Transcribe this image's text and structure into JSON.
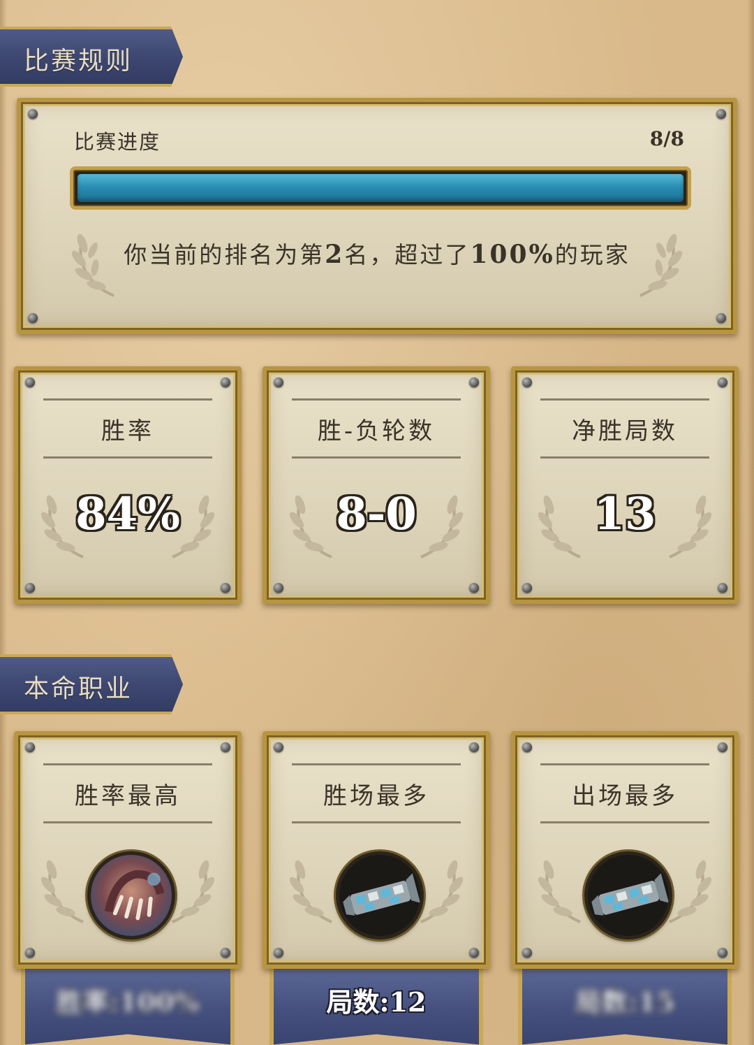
{
  "sections": {
    "rules_title": "比赛规则",
    "class_title": "本命职业"
  },
  "progress": {
    "label": "比赛进度",
    "count": "8/8",
    "fraction": 1.0,
    "rank_prefix": "你当前的排名为第",
    "rank": "2",
    "rank_mid": "名，超过了",
    "percent": "100%",
    "rank_suffix": "的玩家"
  },
  "stats": [
    {
      "title": "胜率",
      "value": "84%"
    },
    {
      "title": "胜-负轮数",
      "value": "8-0"
    },
    {
      "title": "净胜局数",
      "value": "13"
    }
  ],
  "classes": [
    {
      "title": "胜率最高",
      "icon": "claw-class-icon",
      "banner": "胜率:100%"
    },
    {
      "title": "胜场最多",
      "icon": "mech-arm-class-icon",
      "banner": "局数:12"
    },
    {
      "title": "出场最多",
      "icon": "mech-arm-class-icon",
      "banner": "局数:15"
    }
  ],
  "colors": {
    "ribbon": "#3c4670",
    "progress_fill": "#2a8fb3",
    "frame_gold": "#b89540",
    "parchment": "#e2dac1"
  }
}
